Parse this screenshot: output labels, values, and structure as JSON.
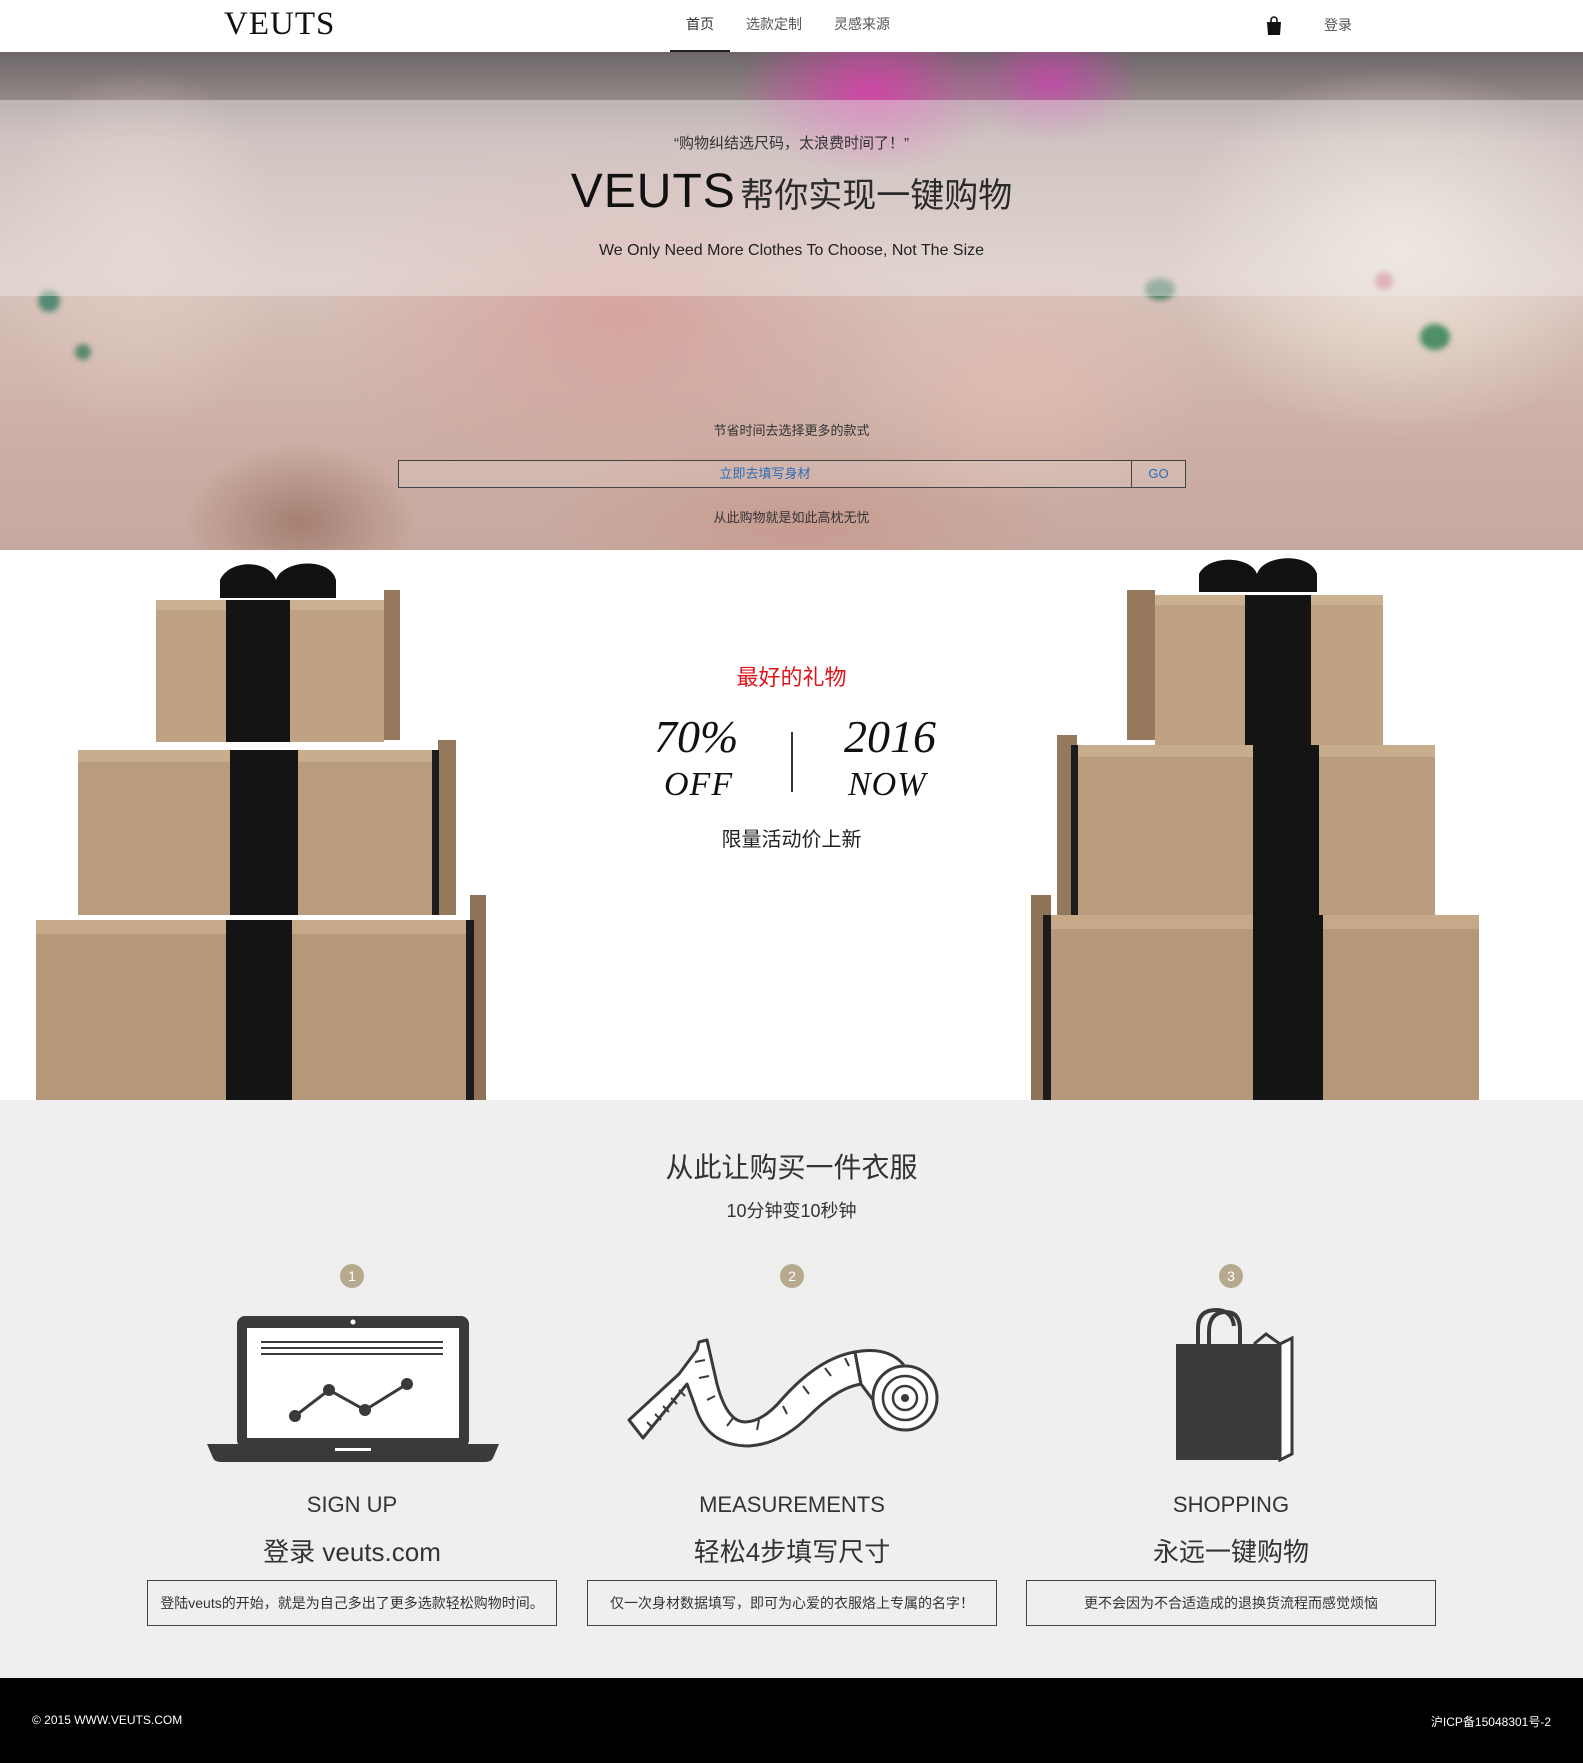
{
  "header": {
    "logo": "VEUTS",
    "nav": [
      {
        "label": "首页",
        "active": true
      },
      {
        "label": "选款定制",
        "active": false
      },
      {
        "label": "灵感来源",
        "active": false
      }
    ],
    "cart_icon": "shopping-bag-icon",
    "login_label": "登录"
  },
  "hero": {
    "quote": "“购物纠结选尺码，太浪费时间了！”",
    "headline_brand": "VEUTS",
    "headline_cn": "帮你实现一键购物",
    "subline": "We Only Need More Clothes To Choose, Not The Size",
    "save_text": "节省时间去选择更多的款式",
    "cta_label": "立即去填写身材",
    "go_label": "GO",
    "worry_text": "从此购物就是如此高枕无忧"
  },
  "gifts": {
    "title": "最好的礼物",
    "discount": "70%",
    "discount_word": "OFF",
    "year": "2016",
    "year_word": "NOW",
    "subtitle": "限量活动价上新"
  },
  "steps_section": {
    "title": "从此让购买一件衣服",
    "subtitle": "10分钟变10秒钟",
    "steps": [
      {
        "number": "1",
        "icon": "laptop-chart-icon",
        "title_en": "SIGN UP",
        "title_cn": "登录 veuts.com",
        "description": "登陆veuts的开始，就是为自己多出了更多选款轻松购物时间。"
      },
      {
        "number": "2",
        "icon": "measuring-tape-icon",
        "title_en": "MEASUREMENTS",
        "title_cn": "轻松4步填写尺寸",
        "description": "仅一次身材数据填写，即可为心爱的衣服烙上专属的名字！"
      },
      {
        "number": "3",
        "icon": "shopping-bag-icon",
        "title_en": "SHOPPING",
        "title_cn": "永远一键购物",
        "description": "更不会因为不合适造成的退换货流程而感觉烦恼"
      }
    ]
  },
  "footer": {
    "copyright": "© 2015 WWW.VEUTS.COM",
    "icp": "沪ICP备15048301号-2"
  },
  "colors": {
    "accent_red": "#e0161b",
    "link_blue": "#2e6db7",
    "step_badge": "#b7a98e",
    "footer_bg": "#000000",
    "steps_bg": "#efefef"
  }
}
